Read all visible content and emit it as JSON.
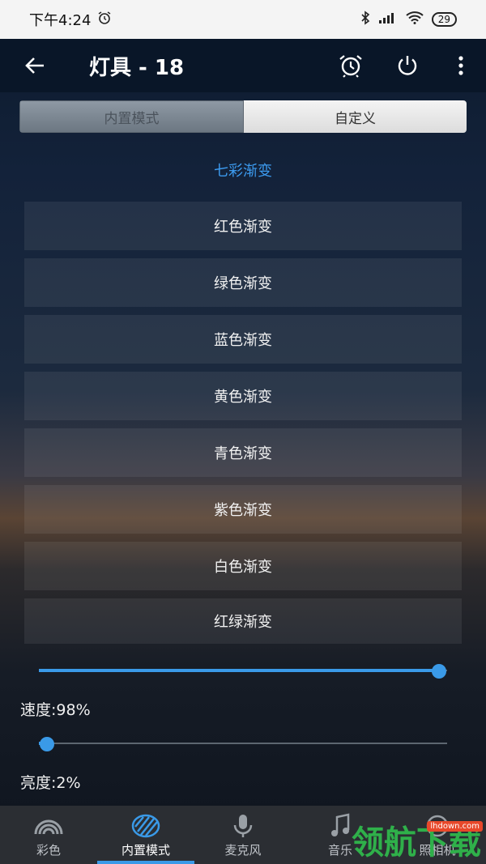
{
  "status_bar": {
    "time": "下午4:24",
    "battery": "29"
  },
  "toolbar": {
    "title": "灯具 - 18"
  },
  "tabs": [
    {
      "label": "内置模式",
      "active": false
    },
    {
      "label": "自定义",
      "active": true
    }
  ],
  "modes": {
    "selected": "七彩渐变",
    "items": [
      "红色渐变",
      "绿色渐变",
      "蓝色渐变",
      "黄色渐变",
      "青色渐变",
      "紫色渐变",
      "白色渐变",
      "红绿渐变"
    ]
  },
  "speed": {
    "label": "速度:98%",
    "value": 0.98
  },
  "brightness": {
    "label": "亮度:2%",
    "value": 0.02
  },
  "bottom_nav": [
    {
      "label": "彩色",
      "icon": "rainbow-icon"
    },
    {
      "label": "内置模式",
      "icon": "striped-circle-icon",
      "active": true
    },
    {
      "label": "麦克风",
      "icon": "microphone-icon"
    },
    {
      "label": "音乐",
      "icon": "music-note-icon"
    },
    {
      "label": "照相机",
      "icon": "camera-icon"
    }
  ],
  "watermark": {
    "text": "领航下载",
    "url": "lhdown.com"
  },
  "colors": {
    "accent": "#3a9ae8",
    "selected_text": "#3c9bef"
  }
}
